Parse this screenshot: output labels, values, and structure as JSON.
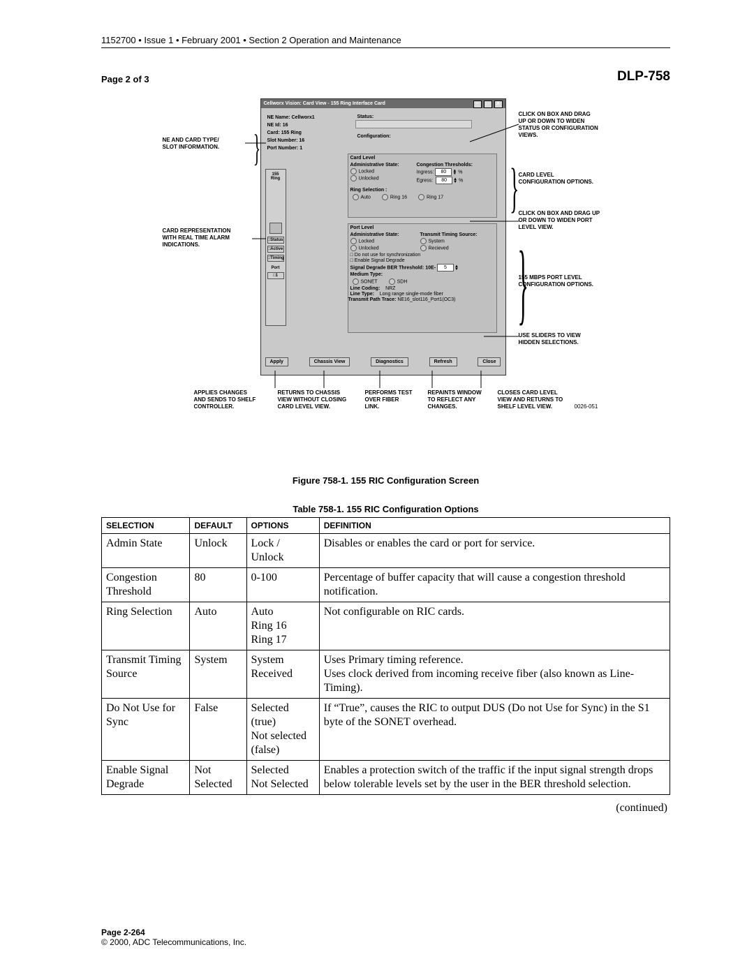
{
  "header_line": "1152700 • Issue 1 • February 2001 • Section 2 Operation and Maintenance",
  "dlp": "DLP-758",
  "page_of": "Page 2 of 3",
  "window": {
    "title": "Cellworx Vision:   Card View  -  155 Ring Interface Card",
    "ne": {
      "name_label": "NE Name:",
      "name": "Cellworx1",
      "id_label": "NE Id:",
      "id": "16",
      "card_label": "Card:",
      "card": "155 Ring",
      "slot_label": "Slot Number:",
      "slot": "16",
      "port_label": "Port Number:",
      "port": "1"
    },
    "status_label": "Status:",
    "config_label": "Configuration:",
    "card_level": {
      "title": "Card Level",
      "adm_label": "Administrative State:",
      "adm_locked": "Locked",
      "adm_unlocked": "Unlocked",
      "cong_label": "Congestion Thresholds:",
      "ingress_label": "Ingress:",
      "egress_label": "Egress:",
      "ingress_val": "80",
      "egress_val": "80",
      "pct": "%",
      "ring_sel_label": "Ring Selection :",
      "ring_auto": "Auto",
      "ring16": "Ring 16",
      "ring17": "Ring 17"
    },
    "port_level": {
      "title": "Port Level",
      "adm_label": "Administrative State:",
      "adm_locked": "Locked",
      "adm_unlocked": "Unlocked",
      "tts_label": "Transmit Timing Source:",
      "tts_sys": "System",
      "tts_rec": "Recieved",
      "dns_label": "Do not use for synchronization",
      "esd_label": "Enable Signal Degrade",
      "sdber_label": "Signal Degrade BER Threshold: 10E-",
      "sdber_val": "5",
      "medium_label": "Medium Type:",
      "medium_sonet": "SONET",
      "medium_sdh": "SDH",
      "linecoding_label": "Line Coding:",
      "linecoding_val": "NRZ",
      "linetype_label": "Line Type:",
      "linetype_val": "Long range single-mode fiber",
      "tpt_label": "Transmit Path Trace:",
      "tpt_val": "NE16_slot116_Port1(OC3)"
    },
    "cardrep": {
      "top": "155\nRing",
      "status": "Status",
      "active": "Active",
      "timing": "Timing",
      "port": "Port",
      "port1": "1"
    },
    "buttons": {
      "apply": "Apply",
      "chassis": "Chassis View",
      "diag": "Diagnostics",
      "refresh": "Refresh",
      "close": "Close"
    }
  },
  "callouts": {
    "ne": "NE AND CARD TYPE/\nSLOT INFORMATION.",
    "rep": "CARD REPRESENTATION\nWITH REAL TIME ALARM\nINDICATIONS.",
    "drag1": "CLICK ON BOX AND DRAG\nUP OR DOWN TO WIDEN\nSTATUS OR CONFIGURATION\nVIEWS.",
    "cardlvl": "CARD LEVEL\nCONFIGURATION OPTIONS.",
    "drag2": "CLICK ON BOX AND DRAG UP\nOR DOWN TO WIDEN PORT\nLEVEL VIEW.",
    "portlvl": "155 MBPS PORT LEVEL\nCONFIGURATION OPTIONS.",
    "sliders": "USE SLIDERS TO VIEW\nHIDDEN SELECTIONS."
  },
  "footer_calls": {
    "apply": "APPLIES CHANGES\nAND SENDS TO SHELF\nCONTROLLER.",
    "chassis": "RETURNS TO CHASSIS\nVIEW WITHOUT CLOSING\nCARD LEVEL VIEW.",
    "diag": "PERFORMS TEST\nOVER FIBER\nLINK.",
    "refresh": "REPAINTS WINDOW\nTO REFLECT ANY\nCHANGES.",
    "close": "CLOSES CARD LEVEL\nVIEW AND RETURNS TO\nSHELF LEVEL VIEW."
  },
  "fig_id": "0026-051",
  "fig_caption": "Figure 758-1. 155 RIC Configuration Screen",
  "tbl_caption": "Table 758-1. 155 RIC Configuration Options",
  "table": {
    "head": {
      "c1": "SELECTION",
      "c2": "DEFAULT",
      "c3": "OPTIONS",
      "c4": "DEFINITION"
    },
    "rows": [
      {
        "c1": "Admin State",
        "c2": "Unlock",
        "c3": "Lock / Unlock",
        "c4": "Disables or enables the card or port for service."
      },
      {
        "c1": "Congestion Threshold",
        "c2": "80",
        "c3": "0-100",
        "c4": "Percentage of buffer capacity that will cause a congestion threshold notification."
      },
      {
        "c1": "Ring Selection",
        "c2": "Auto",
        "c3": "Auto\nRing 16\nRing 17",
        "c4": "Not configurable on RIC cards."
      },
      {
        "c1": "Transmit Timing Source",
        "c2": "System",
        "c3": "System\nReceived",
        "c4": "Uses Primary timing reference.\nUses clock derived from incoming receive fiber (also known as Line-Timing)."
      },
      {
        "c1": "Do Not Use for Sync",
        "c2": "False",
        "c3": "Selected (true)\nNot selected (false)",
        "c4": "If “True”, causes the RIC to output DUS (Do not Use for Sync) in the S1 byte of the SONET overhead."
      },
      {
        "c1": "Enable Signal Degrade",
        "c2": "Not Selected",
        "c3": "Selected\nNot Selected",
        "c4": "Enables a protection switch of the traffic if the input signal strength drops below tolerable levels set by the user in the BER threshold selection."
      }
    ]
  },
  "continued": "(continued)",
  "footer": {
    "page": "Page 2-264",
    "copy": "© 2000, ADC Telecommunications, Inc."
  }
}
